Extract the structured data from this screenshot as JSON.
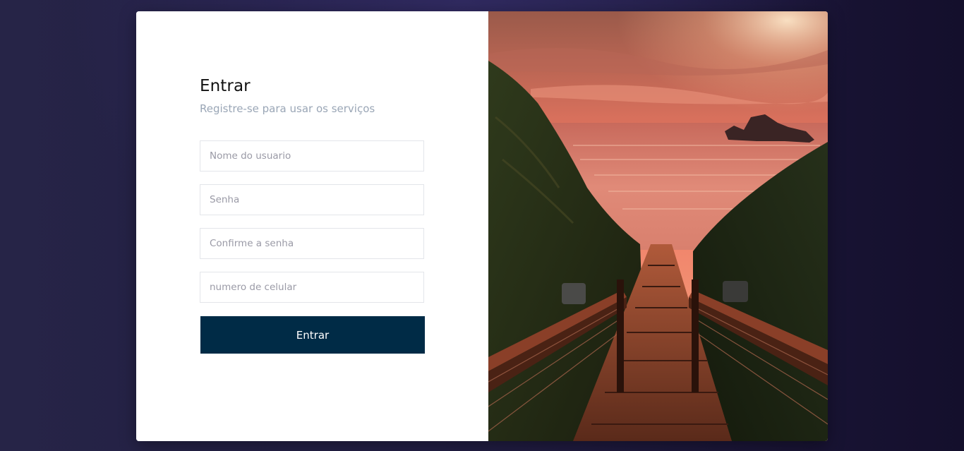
{
  "form": {
    "title": "Entrar",
    "subtitle": "Registre-se para usar os serviços",
    "fields": {
      "username": {
        "placeholder": "Nome do usuario",
        "value": ""
      },
      "password": {
        "placeholder": "Senha",
        "value": ""
      },
      "confirm_password": {
        "placeholder": "Confirme a senha",
        "value": ""
      },
      "phone": {
        "placeholder": "numero de celular",
        "value": ""
      }
    },
    "submit_label": "Entrar"
  },
  "photo": {
    "subject": "sunset-coastal-stairway-photo"
  },
  "colors": {
    "page_background": "#221e44",
    "card_background": "#ffffff",
    "button_background": "#002b46",
    "button_text": "#ffffff",
    "subtitle_text": "#9aa6b6",
    "field_border": "#e3e5ea"
  }
}
